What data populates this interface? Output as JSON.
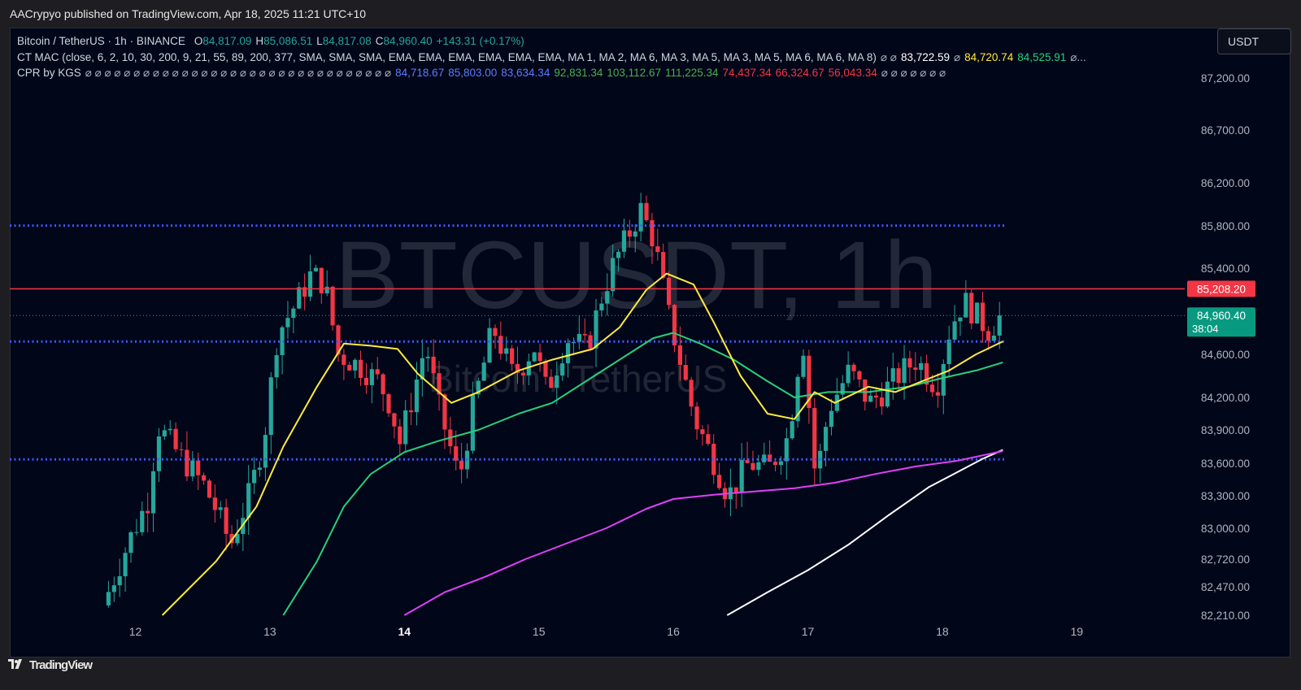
{
  "header": {
    "published_text": "AACrypyo published on TradingView.com, Apr 18, 2025 11:21 UTC+10"
  },
  "legend": {
    "symbol": "Bitcoin / TetherUS · 1h · BINANCE",
    "o_label": "O",
    "o_value": "84,817.09",
    "h_label": "H",
    "h_value": "85,086.51",
    "l_label": "L",
    "l_value": "84,817.08",
    "c_label": "C",
    "c_value": "84,960.40",
    "change": "+143.31 (+0.17%)",
    "ma_name": "CT MAC (close, 6, 2, 10, 30, 200, 9, 21, 55, 89, 200, 377, SMA, SMA, SMA, EMA, EMA, EMA, EMA, EMA, EMA, MA 1, MA 2, MA 6, MA 3, MA 5, MA 3, MA 5, MA 6, MA 6, MA 8)",
    "ma_pre": "⌀ ⌀",
    "ma_values": [
      {
        "text": "83,722.59",
        "color": "#ffffff"
      },
      {
        "text": "⌀",
        "color": "#b2b5be"
      },
      {
        "text": "84,720.74",
        "color": "#ffeb3b"
      },
      {
        "text": "84,525.91",
        "color": "#26d07c"
      },
      {
        "text": "⌀...",
        "color": "#b2b5be"
      }
    ],
    "cpr_name": "CPR by KGS",
    "cpr_pre": "⌀ ⌀ ⌀ ⌀ ⌀ ⌀ ⌀ ⌀ ⌀ ⌀ ⌀ ⌀ ⌀ ⌀ ⌀ ⌀ ⌀ ⌀ ⌀ ⌀ ⌀ ⌀ ⌀ ⌀ ⌀ ⌀ ⌀ ⌀ ⌀ ⌀ ⌀ ⌀",
    "cpr_values": [
      {
        "text": "84,718.67",
        "color": "#5b7cff"
      },
      {
        "text": "85,803.00",
        "color": "#5b7cff"
      },
      {
        "text": "83,634.34",
        "color": "#5b7cff"
      },
      {
        "text": "92,831.34",
        "color": "#4caf50"
      },
      {
        "text": "103,112.67",
        "color": "#4caf50"
      },
      {
        "text": "111,225.34",
        "color": "#4caf50"
      },
      {
        "text": "74,437.34",
        "color": "#f23645"
      },
      {
        "text": "66,324.67",
        "color": "#f23645"
      },
      {
        "text": "56,043.34",
        "color": "#f23645"
      },
      {
        "text": "⌀ ⌀ ⌀ ⌀ ⌀ ⌀ ⌀",
        "color": "#b2b5be"
      }
    ]
  },
  "currency_button": "USDT",
  "footer": {
    "brand": "TradingView"
  },
  "colors": {
    "background": "#010619",
    "up": "#26a69a",
    "down": "#f23645",
    "ma_yellow": "#ffeb3b",
    "ma_green": "#26d07c",
    "ma_magenta": "#e040fb",
    "ma_white": "#ffffff",
    "cpr_blue": "#3d5afe",
    "resistance_red": "#f23645"
  },
  "chart_data": {
    "type": "candlestick",
    "title": "Bitcoin / TetherUS · 1h · BINANCE",
    "watermark": "BTCUSDT, 1h",
    "watermark_sub": "Bitcoin / TetherUS",
    "ylim": [
      82210,
      87400
    ],
    "y_ticks": [
      {
        "value": 87200,
        "label": "87,200.00"
      },
      {
        "value": 86700,
        "label": "86,700.00"
      },
      {
        "value": 86200,
        "label": "86,200.00"
      },
      {
        "value": 85800,
        "label": "85,800.00"
      },
      {
        "value": 85400,
        "label": "85,400.00"
      },
      {
        "value": 84600,
        "label": "84,600.00"
      },
      {
        "value": 84200,
        "label": "84,200.00"
      },
      {
        "value": 83900,
        "label": "83,900.00"
      },
      {
        "value": 83600,
        "label": "83,600.00"
      },
      {
        "value": 83300,
        "label": "83,300.00"
      },
      {
        "value": 83000,
        "label": "83,000.00"
      },
      {
        "value": 82720,
        "label": "82,720.00"
      },
      {
        "value": 82470,
        "label": "82,470.00"
      },
      {
        "value": 82210,
        "label": "82,210.00"
      }
    ],
    "x_ticks": [
      {
        "day": 12,
        "label": "12",
        "bold": false
      },
      {
        "day": 13,
        "label": "13",
        "bold": false
      },
      {
        "day": 14,
        "label": "14",
        "bold": true
      },
      {
        "day": 15,
        "label": "15",
        "bold": false
      },
      {
        "day": 16,
        "label": "16",
        "bold": false
      },
      {
        "day": 17,
        "label": "17",
        "bold": false
      },
      {
        "day": 18,
        "label": "18",
        "bold": false
      },
      {
        "day": 19,
        "label": "19",
        "bold": false
      }
    ],
    "x_range_days": [
      11.05,
      20.5
    ],
    "last_candle_day": 18.45,
    "price_label": {
      "value": 84960.4,
      "text": "84,960.40",
      "countdown": "38:04"
    },
    "red_level": {
      "value": 85208.2,
      "text": "85,208.20"
    },
    "cpr_levels": [
      85803.0,
      84718.67,
      83634.34
    ],
    "candle_keypoints": [
      [
        11.8,
        82300
      ],
      [
        12.0,
        82900
      ],
      [
        12.15,
        83300
      ],
      [
        12.2,
        83950
      ],
      [
        12.35,
        83700
      ],
      [
        12.55,
        83400
      ],
      [
        12.65,
        83150
      ],
      [
        12.75,
        82850
      ],
      [
        12.9,
        83350
      ],
      [
        13.0,
        83850
      ],
      [
        13.1,
        84800
      ],
      [
        13.25,
        85100
      ],
      [
        13.35,
        85350
      ],
      [
        13.45,
        85250
      ],
      [
        13.55,
        84600
      ],
      [
        13.7,
        84500
      ],
      [
        13.85,
        84350
      ],
      [
        13.95,
        84100
      ],
      [
        14.0,
        83750
      ],
      [
        14.1,
        84200
      ],
      [
        14.2,
        84700
      ],
      [
        14.3,
        84100
      ],
      [
        14.45,
        83450
      ],
      [
        14.55,
        84100
      ],
      [
        14.7,
        84850
      ],
      [
        14.85,
        84400
      ],
      [
        14.95,
        84550
      ],
      [
        15.0,
        84700
      ],
      [
        15.1,
        84250
      ],
      [
        15.25,
        84750
      ],
      [
        15.4,
        84650
      ],
      [
        15.5,
        85100
      ],
      [
        15.6,
        85450
      ],
      [
        15.7,
        85700
      ],
      [
        15.8,
        85950
      ],
      [
        15.9,
        85650
      ],
      [
        16.0,
        85000
      ],
      [
        16.1,
        84500
      ],
      [
        16.2,
        84000
      ],
      [
        16.35,
        83600
      ],
      [
        16.45,
        83300
      ],
      [
        16.6,
        83600
      ],
      [
        16.75,
        83550
      ],
      [
        16.9,
        83850
      ],
      [
        17.0,
        84800
      ],
      [
        17.1,
        83450
      ],
      [
        17.2,
        84100
      ],
      [
        17.35,
        84450
      ],
      [
        17.5,
        84150
      ],
      [
        17.6,
        84250
      ],
      [
        17.75,
        84450
      ],
      [
        17.85,
        84550
      ],
      [
        18.0,
        84300
      ],
      [
        18.1,
        84850
      ],
      [
        18.2,
        85100
      ],
      [
        18.3,
        84950
      ],
      [
        18.4,
        84800
      ],
      [
        18.45,
        84960
      ]
    ],
    "ma_yellow": [
      [
        12.2,
        82210
      ],
      [
        12.6,
        82700
      ],
      [
        12.9,
        83200
      ],
      [
        13.1,
        83750
      ],
      [
        13.35,
        84300
      ],
      [
        13.55,
        84700
      ],
      [
        13.75,
        84680
      ],
      [
        13.95,
        84650
      ],
      [
        14.1,
        84420
      ],
      [
        14.35,
        84150
      ],
      [
        14.55,
        84250
      ],
      [
        14.85,
        84450
      ],
      [
        15.1,
        84550
      ],
      [
        15.4,
        84650
      ],
      [
        15.6,
        84850
      ],
      [
        15.8,
        85200
      ],
      [
        15.95,
        85350
      ],
      [
        16.15,
        85250
      ],
      [
        16.3,
        84900
      ],
      [
        16.5,
        84400
      ],
      [
        16.7,
        84050
      ],
      [
        16.9,
        84000
      ],
      [
        17.05,
        84250
      ],
      [
        17.2,
        84150
      ],
      [
        17.45,
        84300
      ],
      [
        17.65,
        84250
      ],
      [
        17.85,
        84350
      ],
      [
        18.05,
        84450
      ],
      [
        18.25,
        84600
      ],
      [
        18.45,
        84720
      ]
    ],
    "ma_green": [
      [
        13.1,
        82210
      ],
      [
        13.35,
        82700
      ],
      [
        13.55,
        83200
      ],
      [
        13.75,
        83500
      ],
      [
        14.0,
        83700
      ],
      [
        14.25,
        83800
      ],
      [
        14.55,
        83900
      ],
      [
        14.85,
        84050
      ],
      [
        15.1,
        84150
      ],
      [
        15.35,
        84350
      ],
      [
        15.6,
        84550
      ],
      [
        15.85,
        84750
      ],
      [
        16.0,
        84800
      ],
      [
        16.2,
        84700
      ],
      [
        16.45,
        84550
      ],
      [
        16.7,
        84350
      ],
      [
        16.9,
        84200
      ],
      [
        17.15,
        84250
      ],
      [
        17.45,
        84250
      ],
      [
        17.75,
        84300
      ],
      [
        18.0,
        84380
      ],
      [
        18.25,
        84450
      ],
      [
        18.45,
        84525
      ]
    ],
    "ma_magenta": [
      [
        14.0,
        82210
      ],
      [
        14.3,
        82420
      ],
      [
        14.6,
        82560
      ],
      [
        14.9,
        82720
      ],
      [
        15.2,
        82860
      ],
      [
        15.5,
        83000
      ],
      [
        15.8,
        83180
      ],
      [
        16.0,
        83270
      ],
      [
        16.3,
        83310
      ],
      [
        16.6,
        83340
      ],
      [
        16.9,
        83370
      ],
      [
        17.2,
        83420
      ],
      [
        17.5,
        83500
      ],
      [
        17.8,
        83570
      ],
      [
        18.1,
        83620
      ],
      [
        18.45,
        83710
      ]
    ],
    "ma_white": [
      [
        16.4,
        82210
      ],
      [
        16.7,
        82420
      ],
      [
        17.0,
        82620
      ],
      [
        17.3,
        82850
      ],
      [
        17.6,
        83120
      ],
      [
        17.9,
        83380
      ],
      [
        18.1,
        83510
      ],
      [
        18.3,
        83640
      ],
      [
        18.45,
        83720
      ]
    ]
  }
}
